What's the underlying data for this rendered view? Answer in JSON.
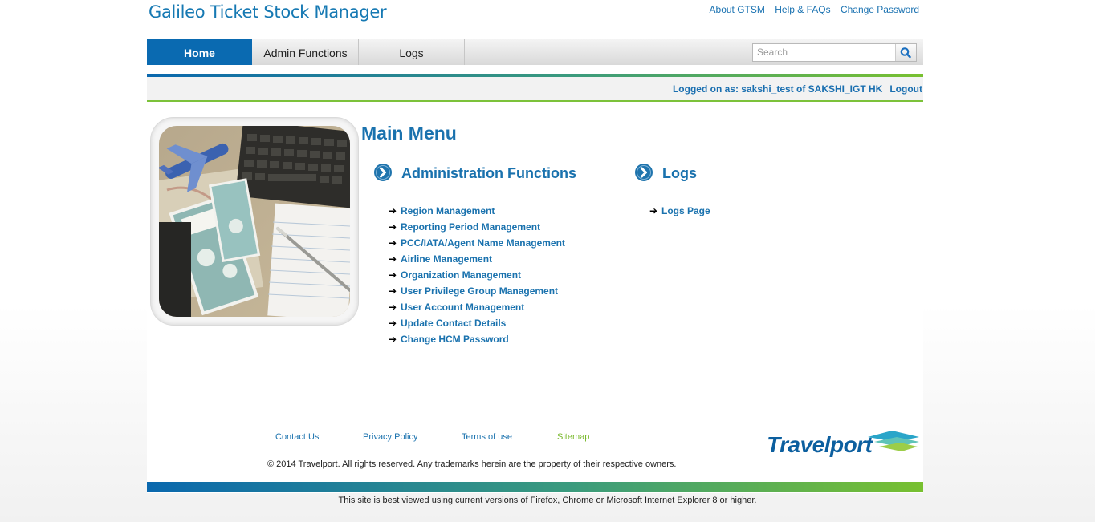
{
  "header": {
    "app_title": "Galileo Ticket Stock Manager",
    "links": [
      "About GTSM",
      "Help & FAQs",
      "Change Password"
    ]
  },
  "nav": {
    "tabs": [
      {
        "label": "Home",
        "active": true
      },
      {
        "label": "Admin Functions",
        "active": false
      },
      {
        "label": "Logs",
        "active": false
      }
    ],
    "search_placeholder": "Search",
    "search_icon": "search-icon"
  },
  "session": {
    "logged_on_text": "Logged on as: sakshi_test of SAKSHI_IGT HK",
    "logout_label": "Logout"
  },
  "main": {
    "title": "Main Menu",
    "sections": [
      {
        "title": "Administration Functions",
        "icon": "chevron-circle-icon",
        "items": [
          "Region Management",
          "Reporting Period Management",
          "PCC/IATA/Agent Name Management",
          "Airline Management",
          "Organization Management",
          "User Privilege Group Management",
          "User Account Management",
          "Update Contact Details",
          "Change HCM Password"
        ]
      },
      {
        "title": "Logs",
        "icon": "chevron-circle-icon",
        "items": [
          "Logs Page"
        ]
      }
    ]
  },
  "footer": {
    "links": [
      "Contact Us",
      "Privacy Policy",
      "Terms of use",
      "Sitemap"
    ],
    "copyright": "© 2014 Travelport. All rights reserved. Any trademarks herein are the property of their respective owners.",
    "logo_text": "Travelport",
    "best_viewed": "This site is best viewed using current versions of Firefox, Chrome or Microsoft Internet Explorer 8 or higher."
  },
  "colors": {
    "brand_blue": "#1a72ae",
    "active_tab": "#0a6ab1",
    "accent_green": "#7cc23a",
    "sitemap_green": "#78b82a"
  }
}
